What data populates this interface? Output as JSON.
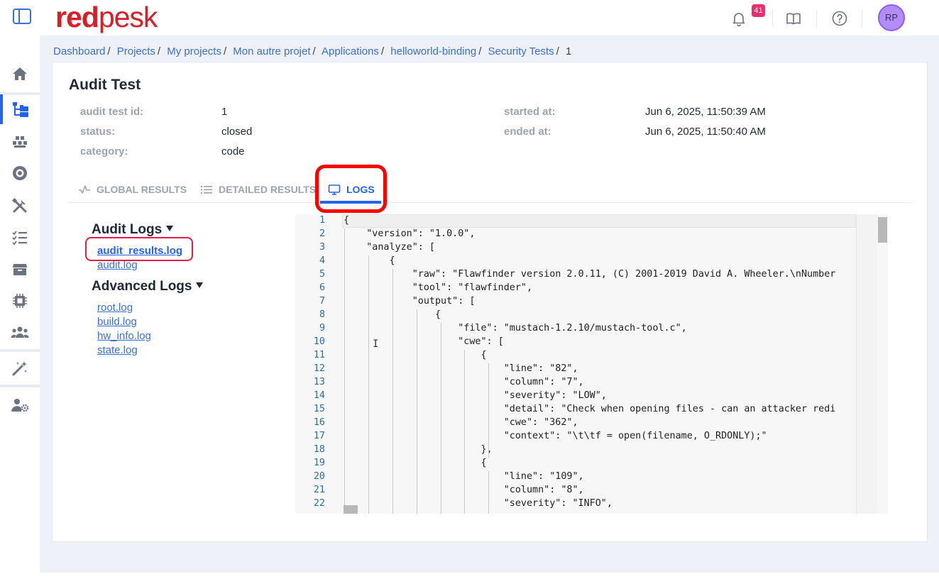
{
  "app": {
    "logo_red": "red",
    "logo_pesk": "pesk",
    "notifications_count": "41",
    "avatar_initials": "RP"
  },
  "breadcrumb": [
    "Dashboard",
    "Projects",
    "My projects",
    "Mon autre projet",
    "Applications",
    "helloworld-binding",
    "Security Tests",
    "1"
  ],
  "audit": {
    "title": "Audit Test",
    "id_label": "audit test id:",
    "id_value": "1",
    "status_label": "status:",
    "status_value": "closed",
    "category_label": "category:",
    "category_value": "code",
    "started_label": "started at:",
    "started_value": "Jun 6, 2025, 11:50:39 AM",
    "ended_label": "ended at:",
    "ended_value": "Jun 6, 2025, 11:50:40 AM"
  },
  "tabs": {
    "global": "GLOBAL RESULTS",
    "detailed": "DETAILED RESULTS",
    "logs": "LOGS",
    "active": "logs"
  },
  "logs": {
    "audit_heading": "Audit Logs",
    "audit_files": [
      "audit_results.log",
      "audit.log"
    ],
    "advanced_heading": "Advanced Logs",
    "advanced_files": [
      "root.log",
      "build.log",
      "hw_info.log",
      "state.log"
    ]
  },
  "editor": {
    "lines": [
      "{",
      "    \"version\": \"1.0.0\",",
      "    \"analyze\": [",
      "        {",
      "            \"raw\": \"Flawfinder version 2.0.11, (C) 2001-2019 David A. Wheeler.\\nNumber",
      "            \"tool\": \"flawfinder\",",
      "            \"output\": [",
      "                {",
      "                    \"file\": \"mustach-1.2.10/mustach-tool.c\",",
      "                    \"cwe\": [",
      "                        {",
      "                            \"line\": \"82\",",
      "                            \"column\": \"7\",",
      "                            \"severity\": \"LOW\",",
      "                            \"detail\": \"Check when opening files - can an attacker redi",
      "                            \"cwe\": \"362\",",
      "                            \"context\": \"\\t\\tf = open(filename, O_RDONLY);\"",
      "                        },",
      "                        {",
      "                            \"line\": \"109\",",
      "                            \"column\": \"8\",",
      "                            \"severity\": \"INFO\","
    ]
  },
  "colors": {
    "brand_red": "#d61f26",
    "accent_blue": "#2563eb",
    "highlight_red": "#ff0000",
    "badge_pink": "#ee2d6e",
    "avatar_purple": "#b38cf5"
  }
}
